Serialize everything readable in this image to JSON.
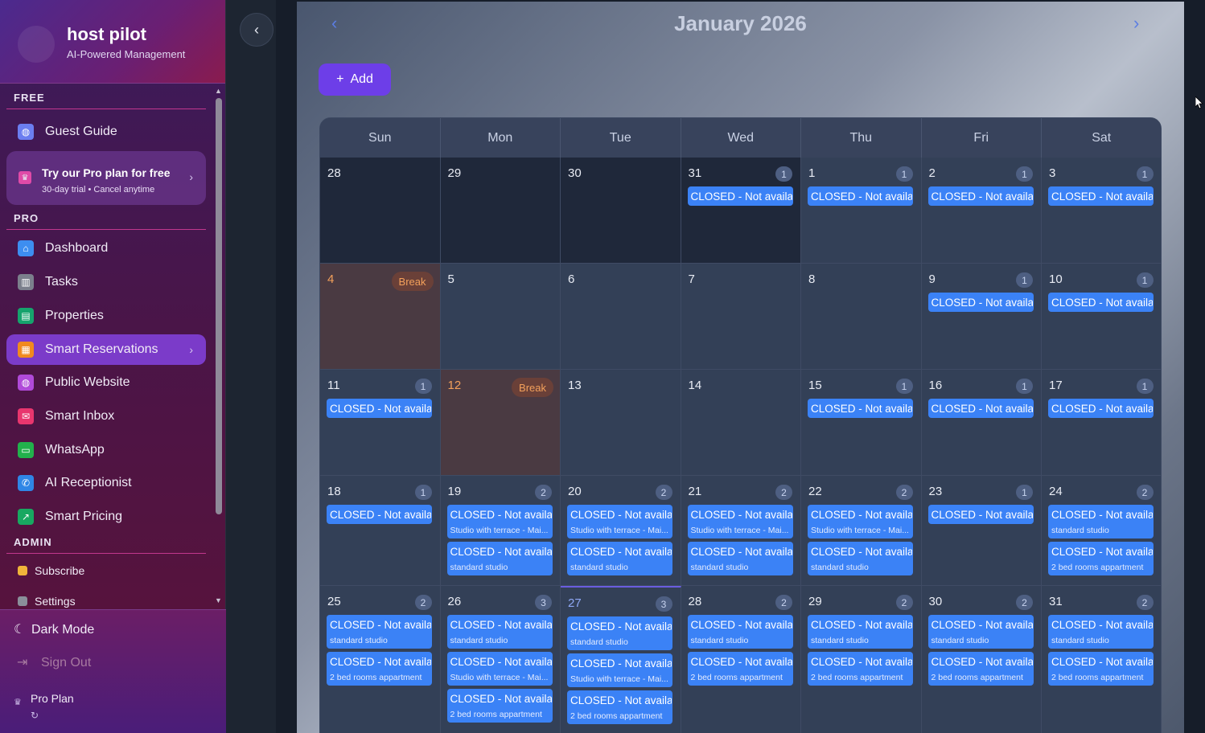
{
  "brand": {
    "name": "host pilot",
    "tagline": "AI-Powered Management"
  },
  "sections": {
    "free": "FREE",
    "pro": "PRO",
    "admin": "ADMIN"
  },
  "nav": {
    "guest_guide": "Guest Guide",
    "promo_title": "Try our Pro plan for free",
    "promo_sub": "30-day trial • Cancel anytime",
    "dashboard": "Dashboard",
    "tasks": "Tasks",
    "properties": "Properties",
    "smart_reservations": "Smart Reservations",
    "public_website": "Public Website",
    "smart_inbox": "Smart Inbox",
    "whatsapp": "WhatsApp",
    "ai_receptionist": "AI Receptionist",
    "smart_pricing": "Smart Pricing",
    "subscribe": "Subscribe",
    "settings": "Settings"
  },
  "bottom": {
    "dark_mode": "Dark Mode",
    "sign_out": "Sign Out",
    "plan": "Pro Plan"
  },
  "calendar": {
    "month_title": "January 2026",
    "add_label": "Add",
    "weekdays": [
      "Sun",
      "Mon",
      "Tue",
      "Wed",
      "Thu",
      "Fri",
      "Sat"
    ],
    "break_label": "Break",
    "weeks": [
      [
        {
          "d": "28",
          "dark": true,
          "events": []
        },
        {
          "d": "29",
          "dark": true,
          "events": []
        },
        {
          "d": "30",
          "dark": true,
          "events": []
        },
        {
          "d": "31",
          "dark": true,
          "count": "1",
          "events": [
            {
              "t": "CLOSED - Not availa"
            }
          ]
        },
        {
          "d": "1",
          "count": "1",
          "events": [
            {
              "t": "CLOSED - Not availa"
            }
          ]
        },
        {
          "d": "2",
          "count": "1",
          "events": [
            {
              "t": "CLOSED - Not availa"
            }
          ]
        },
        {
          "d": "3",
          "count": "1",
          "events": [
            {
              "t": "CLOSED - Not availa"
            }
          ]
        }
      ],
      [
        {
          "d": "4",
          "brk": true,
          "events": []
        },
        {
          "d": "5",
          "events": []
        },
        {
          "d": "6",
          "events": []
        },
        {
          "d": "7",
          "events": []
        },
        {
          "d": "8",
          "events": []
        },
        {
          "d": "9",
          "count": "1",
          "events": [
            {
              "t": "CLOSED - Not availa"
            }
          ]
        },
        {
          "d": "10",
          "count": "1",
          "events": [
            {
              "t": "CLOSED - Not availa"
            }
          ]
        }
      ],
      [
        {
          "d": "11",
          "count": "1",
          "events": [
            {
              "t": "CLOSED - Not availa"
            }
          ]
        },
        {
          "d": "12",
          "brk": true,
          "events": []
        },
        {
          "d": "13",
          "events": []
        },
        {
          "d": "14",
          "events": []
        },
        {
          "d": "15",
          "count": "1",
          "events": [
            {
              "t": "CLOSED - Not availa"
            }
          ]
        },
        {
          "d": "16",
          "count": "1",
          "events": [
            {
              "t": "CLOSED - Not availa"
            }
          ]
        },
        {
          "d": "17",
          "count": "1",
          "events": [
            {
              "t": "CLOSED - Not availa"
            }
          ]
        }
      ],
      [
        {
          "d": "18",
          "count": "1",
          "events": [
            {
              "t": "CLOSED - Not availa"
            }
          ]
        },
        {
          "d": "19",
          "count": "2",
          "events": [
            {
              "t": "CLOSED - Not availa",
              "s": "Studio with terrace - Mai..."
            },
            {
              "t": "CLOSED - Not availa",
              "s": "standard studio"
            }
          ]
        },
        {
          "d": "20",
          "count": "2",
          "events": [
            {
              "t": "CLOSED - Not availa",
              "s": "Studio with terrace - Mai..."
            },
            {
              "t": "CLOSED - Not availa",
              "s": "standard studio"
            }
          ]
        },
        {
          "d": "21",
          "count": "2",
          "events": [
            {
              "t": "CLOSED - Not availa",
              "s": "Studio with terrace - Mai..."
            },
            {
              "t": "CLOSED - Not availa",
              "s": "standard studio"
            }
          ]
        },
        {
          "d": "22",
          "count": "2",
          "events": [
            {
              "t": "CLOSED - Not availa",
              "s": "Studio with terrace - Mai..."
            },
            {
              "t": "CLOSED - Not availa",
              "s": "standard studio"
            }
          ]
        },
        {
          "d": "23",
          "count": "1",
          "events": [
            {
              "t": "CLOSED - Not availa"
            }
          ]
        },
        {
          "d": "24",
          "count": "2",
          "events": [
            {
              "t": "CLOSED - Not availa",
              "s": "standard studio"
            },
            {
              "t": "CLOSED - Not availa",
              "s": "2 bed rooms appartment"
            }
          ]
        }
      ],
      [
        {
          "d": "25",
          "count": "2",
          "events": [
            {
              "t": "CLOSED - Not availa",
              "s": "standard studio"
            },
            {
              "t": "CLOSED - Not availa",
              "s": "2 bed rooms appartment"
            }
          ]
        },
        {
          "d": "26",
          "count": "3",
          "events": [
            {
              "t": "CLOSED - Not availa",
              "s": "standard studio"
            },
            {
              "t": "CLOSED - Not availa",
              "s": "Studio with terrace - Mai..."
            },
            {
              "t": "CLOSED - Not availa",
              "s": "2 bed rooms appartment"
            }
          ]
        },
        {
          "d": "27",
          "today": true,
          "count": "3",
          "events": [
            {
              "t": "CLOSED - Not availa",
              "s": "standard studio"
            },
            {
              "t": "CLOSED - Not availa",
              "s": "Studio with terrace - Mai..."
            },
            {
              "t": "CLOSED - Not availa",
              "s": "2 bed rooms appartment"
            }
          ]
        },
        {
          "d": "28",
          "count": "2",
          "events": [
            {
              "t": "CLOSED - Not availa",
              "s": "standard studio"
            },
            {
              "t": "CLOSED - Not availa",
              "s": "2 bed rooms appartment"
            }
          ]
        },
        {
          "d": "29",
          "count": "2",
          "events": [
            {
              "t": "CLOSED - Not availa",
              "s": "standard studio"
            },
            {
              "t": "CLOSED - Not availa",
              "s": "2 bed rooms appartment"
            }
          ]
        },
        {
          "d": "30",
          "count": "2",
          "events": [
            {
              "t": "CLOSED - Not availa",
              "s": "standard studio"
            },
            {
              "t": "CLOSED - Not availa",
              "s": "2 bed rooms appartment"
            }
          ]
        },
        {
          "d": "31",
          "count": "2",
          "events": [
            {
              "t": "CLOSED - Not availa",
              "s": "standard studio"
            },
            {
              "t": "CLOSED - Not availa",
              "s": "2 bed rooms appartment"
            }
          ]
        }
      ]
    ]
  }
}
